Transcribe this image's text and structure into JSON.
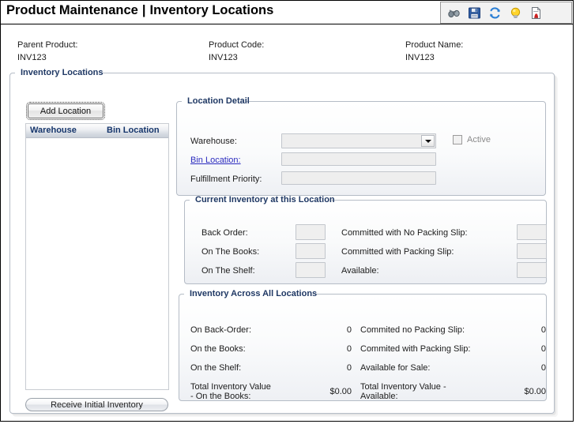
{
  "header": {
    "title_primary": "Product Maintenance",
    "separator": "|",
    "title_secondary": "Inventory Locations",
    "toolbar": [
      {
        "name": "binoculars-icon",
        "label": "Search"
      },
      {
        "name": "save-icon",
        "label": "Save"
      },
      {
        "name": "refresh-icon",
        "label": "Refresh"
      },
      {
        "name": "lightbulb-icon",
        "label": "Hints"
      },
      {
        "name": "report-icon",
        "label": "Report"
      }
    ]
  },
  "product_info": {
    "parent_product_label": "Parent Product:",
    "parent_product_value": "INV123",
    "product_code_label": "Product Code:",
    "product_code_value": "INV123",
    "product_name_label": "Product Name:",
    "product_name_value": "INV123"
  },
  "inventory_locations": {
    "group_title": "Inventory Locations",
    "add_location_label": "Add Location",
    "list_headers": [
      "Warehouse",
      "Bin Location"
    ],
    "list_rows": [],
    "receive_initial_inventory_label": "Receive Initial Inventory"
  },
  "location_detail": {
    "group_title": "Location Detail",
    "warehouse_label": "Warehouse:",
    "warehouse_value": "",
    "warehouse_options": [],
    "bin_location_label": "Bin Location:",
    "bin_location_value": "",
    "fulfillment_priority_label": "Fulfillment Priority:",
    "fulfillment_priority_value": "",
    "active_label": "Active",
    "active_checked": false
  },
  "current_inventory": {
    "group_title": "Current Inventory at this Location",
    "left": [
      {
        "label": "Back Order:",
        "value": ""
      },
      {
        "label": "On The Books:",
        "value": ""
      },
      {
        "label": "On The Shelf:",
        "value": ""
      }
    ],
    "right": [
      {
        "label": "Committed with No Packing Slip:",
        "value": ""
      },
      {
        "label": "Committed with Packing Slip:",
        "value": ""
      },
      {
        "label": "Available:",
        "value": ""
      }
    ]
  },
  "all_locations": {
    "group_title": "Inventory Across All Locations",
    "left": [
      {
        "label": "On Back-Order:",
        "value": "0"
      },
      {
        "label": "On the Books:",
        "value": "0"
      },
      {
        "label": "On the Shelf:",
        "value": "0"
      },
      {
        "label_line1": "Total Inventory Value",
        "label_line2": "- On the Books:",
        "value": "$0.00"
      }
    ],
    "right": [
      {
        "label": "Commited no Packing Slip:",
        "value": "0"
      },
      {
        "label": "Commited with Packing Slip:",
        "value": "0"
      },
      {
        "label": "Available for Sale:",
        "value": "0"
      },
      {
        "label_line1": "Total Inventory Value -",
        "label_line2": "Available:",
        "value": "$0.00"
      }
    ]
  },
  "colors": {
    "group_title": "#1f3864",
    "link": "#2b2bbf",
    "list_header_text": "#15356b",
    "disabled_text": "#8b8b8b"
  }
}
